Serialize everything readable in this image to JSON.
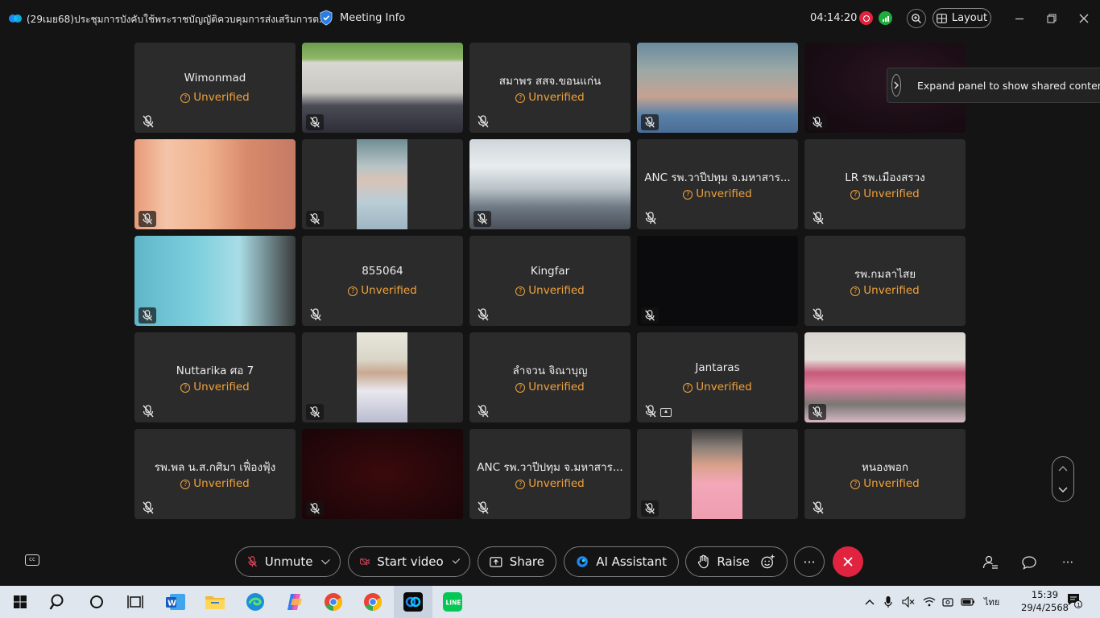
{
  "window": {
    "meeting_title": "(29เมย68)ประชุมการบังคับใช้พระราชบัญญัติควบคุมการส่งเสริมการต...",
    "meeting_info": "Meeting Info",
    "timer": "04:14:20",
    "layout_label": "Layout"
  },
  "panel": {
    "expand_label": "Expand panel to show shared content"
  },
  "unverified_label": "Unverified",
  "tiles": [
    {
      "name": "Wimonmad",
      "unverified": true
    },
    {
      "name": "",
      "video": "office"
    },
    {
      "name": "สมาพร สสจ.ขอนแก่น",
      "unverified": true
    },
    {
      "name": "",
      "video": "redface"
    },
    {
      "name": "",
      "video": "darkpurple"
    },
    {
      "name": "",
      "video": "pinkcurtain"
    },
    {
      "name": "",
      "video": "narrow-nurse"
    },
    {
      "name": "",
      "video": "room"
    },
    {
      "name": "ANC รพ.วาปีปทุม จ.มหาสาร...",
      "unverified": true
    },
    {
      "name": "LR รพ.เมืองสรวง",
      "unverified": true
    },
    {
      "name": "",
      "video": "cyan"
    },
    {
      "name": "855064",
      "unverified": true
    },
    {
      "name": "Kingfar",
      "unverified": true
    },
    {
      "name": "",
      "video": "dark"
    },
    {
      "name": "รพ.กมลาไสย",
      "unverified": true
    },
    {
      "name": "Nuttarika ศอ 7",
      "unverified": true
    },
    {
      "name": "",
      "video": "narrow-headset"
    },
    {
      "name": "ลำจวน จิณาบุญ",
      "unverified": true
    },
    {
      "name": "Jantaras",
      "unverified": true
    },
    {
      "name": "",
      "video": "pinkroom"
    },
    {
      "name": "รพ.พล น.ส.กศิมา เฟื่องฟุ้ง",
      "unverified": true
    },
    {
      "name": "",
      "video": "darkred"
    },
    {
      "name": "ANC รพ.วาปีปทุม จ.มหาสาร...",
      "unverified": true
    },
    {
      "name": "",
      "video": "narrow-car"
    },
    {
      "name": "หนองพอก",
      "unverified": true
    }
  ],
  "toolbar": {
    "unmute": "Unmute",
    "start_video": "Start video",
    "share": "Share",
    "ai_assistant": "AI Assistant",
    "raise": "Raise",
    "more": "···"
  },
  "taskbar": {
    "lang": "ไทย",
    "time": "15:39",
    "date": "29/4/2568",
    "notif_count": "1"
  },
  "colors": {
    "unverified": "#f2a23a",
    "leave": "#e0243f",
    "record": "#e0243f",
    "stats": "#1fae3c"
  }
}
